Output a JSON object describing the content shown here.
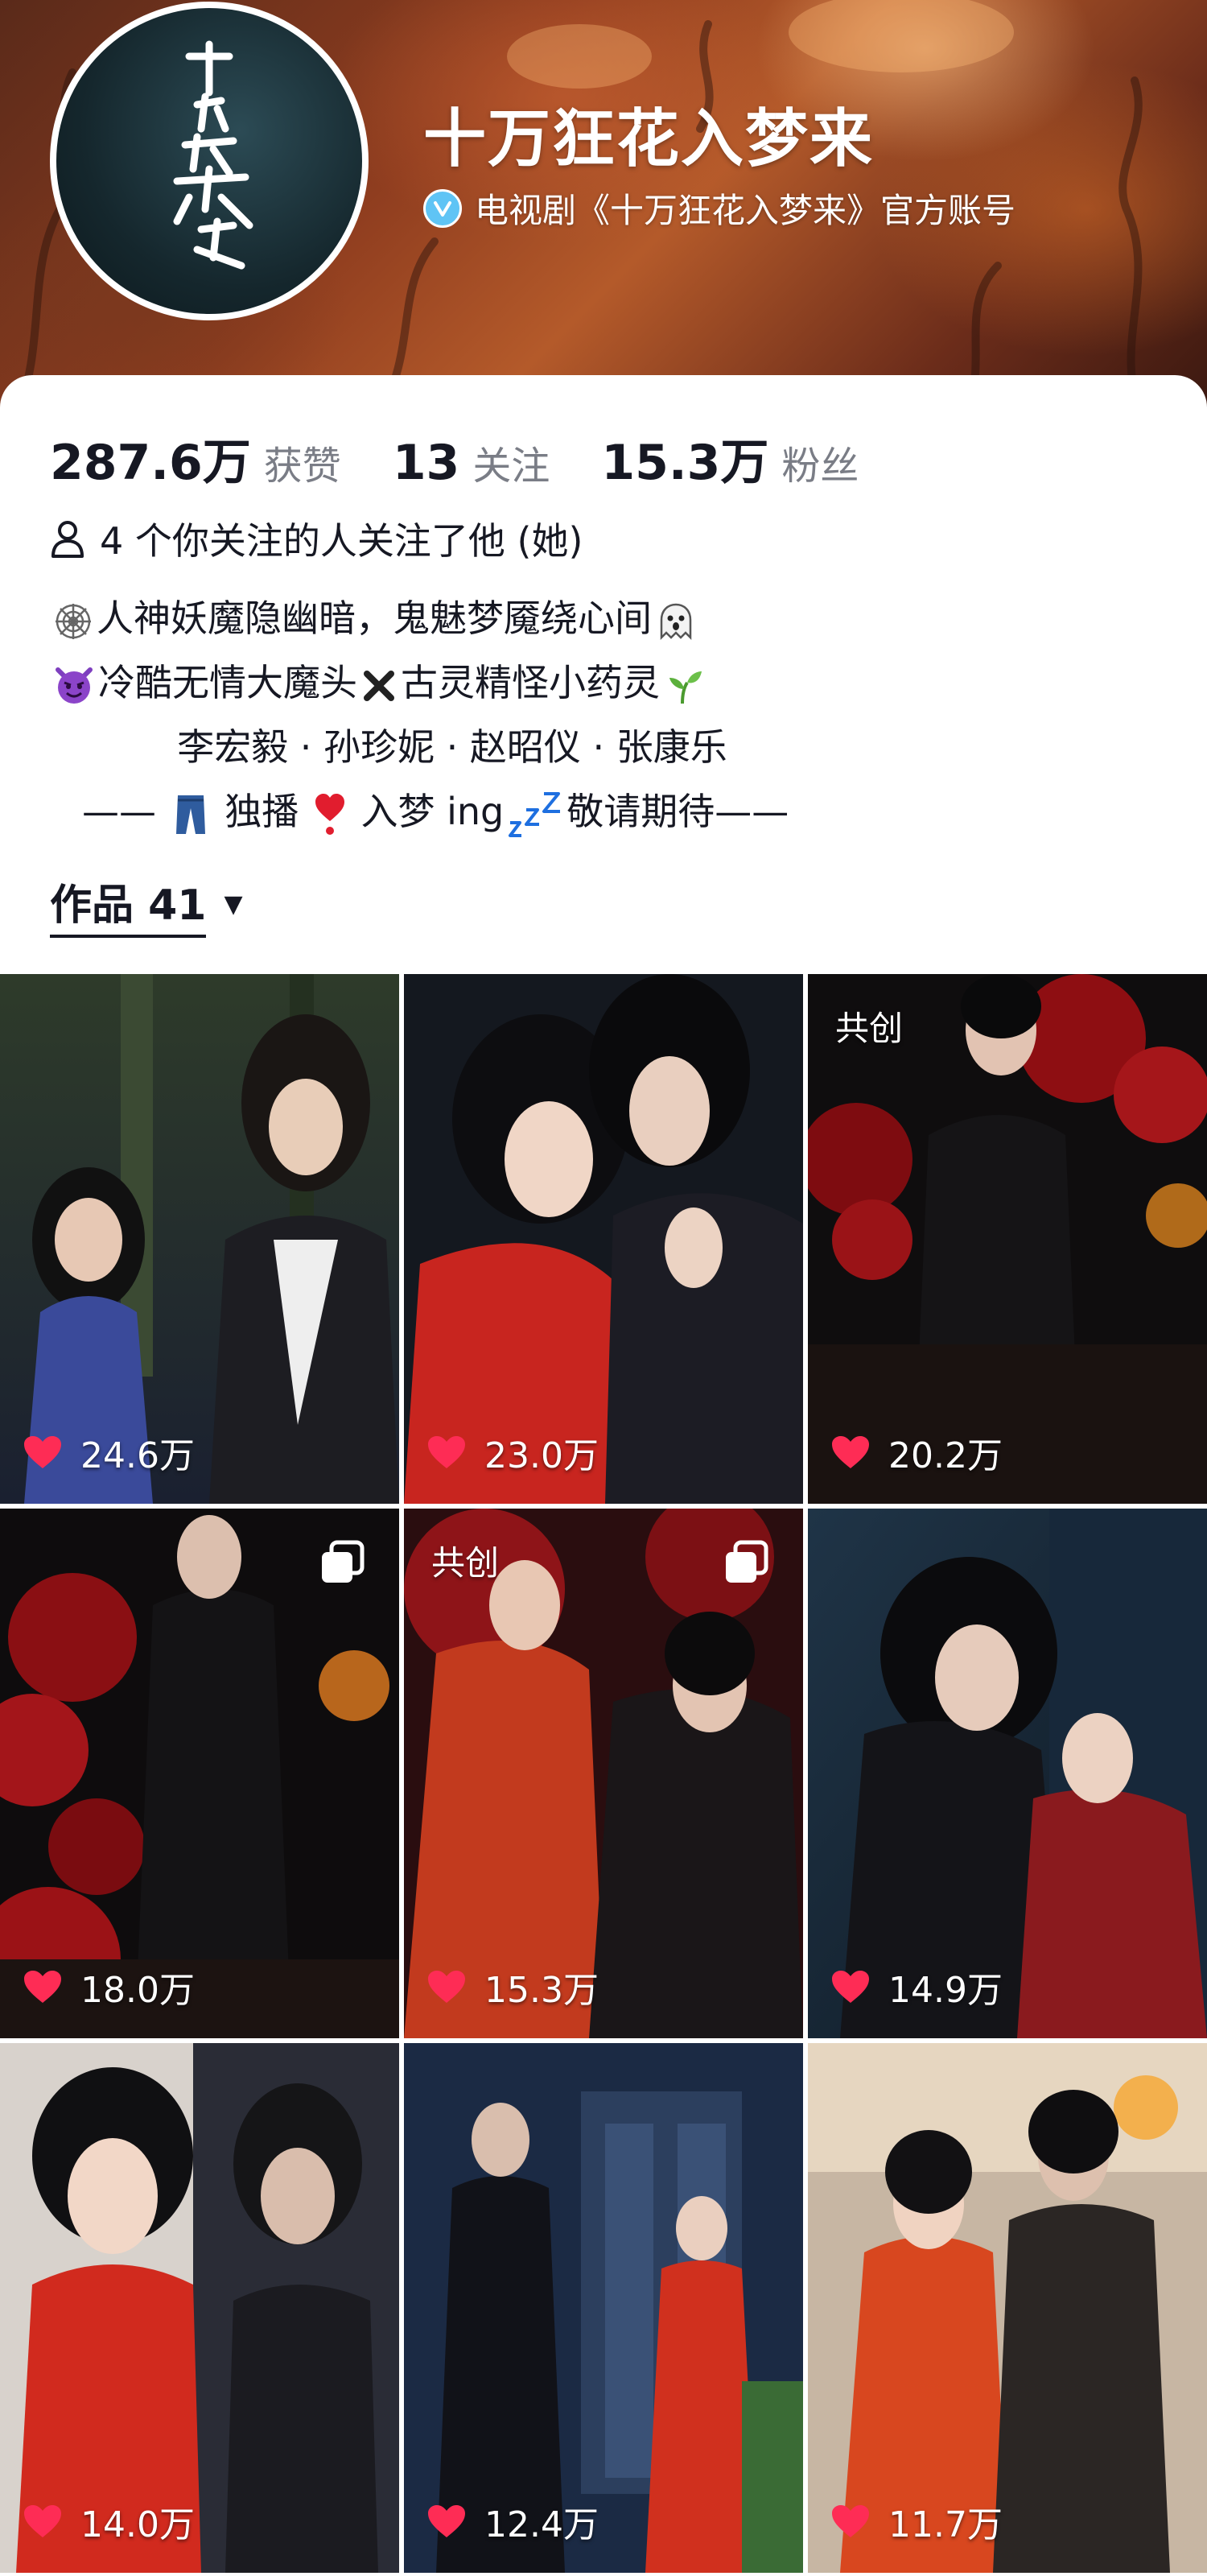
{
  "account": {
    "name": "十万狂花入梦来",
    "verify_text": "电视剧《十万狂花入梦来》官方账号",
    "avatar_text": "十万狂花入梦来"
  },
  "stats": [
    {
      "value": "287.6万",
      "label": "获赞"
    },
    {
      "value": "13",
      "label": "关注"
    },
    {
      "value": "15.3万",
      "label": "粉丝"
    }
  ],
  "mutual_text": "4 个你关注的人关注了他 (她)",
  "bio": {
    "line1": "人神妖魔隐幽暗，鬼魅梦魇绕心间",
    "line2a": "冷酷无情大魔头",
    "line2b": "古灵精怪小药灵",
    "line3": "李宏毅 · 孙珍妮 · 赵昭仪 · 张康乐",
    "line4a": "——",
    "line4b": "独播",
    "line4c": "入梦 ing",
    "line4d": "敬请期待——"
  },
  "works_tab": {
    "label": "作品 41"
  },
  "colors": {
    "like_red": "#fe2c55",
    "verify_blue": "#5fc4f5"
  },
  "videos": [
    {
      "likes": "24.6万",
      "tag": "",
      "multi": false
    },
    {
      "likes": "23.0万",
      "tag": "",
      "multi": false
    },
    {
      "likes": "20.2万",
      "tag": "共创",
      "multi": false
    },
    {
      "likes": "18.0万",
      "tag": "",
      "multi": true
    },
    {
      "likes": "15.3万",
      "tag": "共创",
      "multi": true
    },
    {
      "likes": "14.9万",
      "tag": "",
      "multi": false
    },
    {
      "likes": "14.0万",
      "tag": "",
      "multi": false
    },
    {
      "likes": "12.4万",
      "tag": "",
      "multi": false
    },
    {
      "likes": "11.7万",
      "tag": "",
      "multi": false
    }
  ]
}
